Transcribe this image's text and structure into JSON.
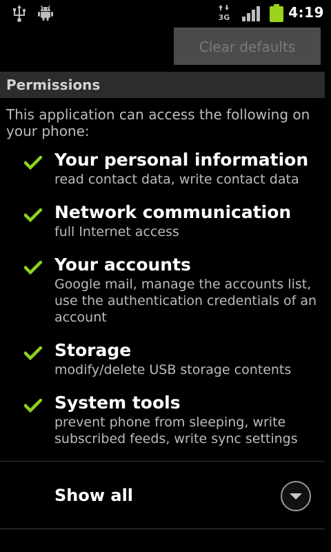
{
  "status_bar": {
    "time": "4:19",
    "network_label": "3G",
    "icons": [
      "usb-icon",
      "android-debug-icon",
      "network-3g-icon",
      "signal-icon",
      "battery-icon"
    ],
    "battery_color": "#9bd21c"
  },
  "clear_defaults_button": {
    "label": "Clear defaults"
  },
  "permissions": {
    "header": "Permissions",
    "intro": "This application can access the following on your phone:",
    "items": [
      {
        "title": "Your personal information",
        "description": "read contact data, write contact data"
      },
      {
        "title": "Network communication",
        "description": "full Internet access"
      },
      {
        "title": "Your accounts",
        "description": "Google mail, manage the accounts list, use the authentication credentials of an account"
      },
      {
        "title": "Storage",
        "description": "modify/delete USB storage contents"
      },
      {
        "title": "System tools",
        "description": "prevent phone from sleeping, write subscribed feeds, write sync settings"
      }
    ],
    "check_color": "#8ed31d"
  },
  "show_all": {
    "label": "Show all"
  }
}
